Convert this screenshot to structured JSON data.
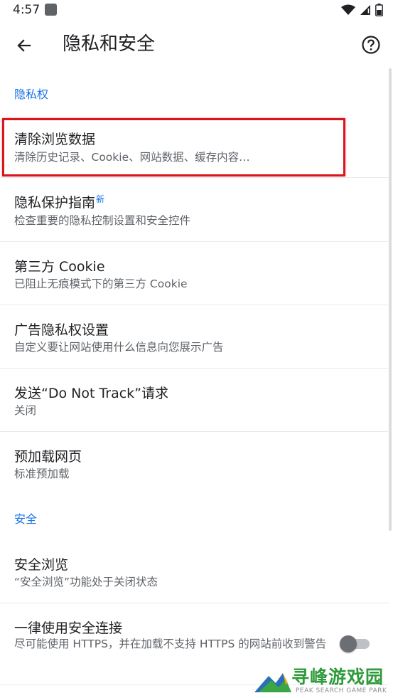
{
  "status_bar": {
    "time": "4:57"
  },
  "header": {
    "title": "隐私和安全"
  },
  "sections": {
    "privacy_header": "隐私权",
    "security_header": "安全"
  },
  "items": {
    "clear_data": {
      "title": "清除浏览数据",
      "subtitle": "清除历史记录、Cookie、网站数据、缓存内容…"
    },
    "privacy_guide": {
      "title": "隐私保护指南",
      "badge": "新",
      "subtitle": "检查重要的隐私控制设置和安全控件"
    },
    "third_party_cookie": {
      "title": "第三方 Cookie",
      "subtitle": "已阻止无痕模式下的第三方 Cookie"
    },
    "ad_privacy": {
      "title": "广告隐私权设置",
      "subtitle": "自定义要让网站使用什么信息向您展示广告"
    },
    "do_not_track": {
      "title": "发送“Do Not Track”请求",
      "subtitle": "关闭"
    },
    "preload": {
      "title": "预加载网页",
      "subtitle": "标准预加载"
    },
    "safe_browsing": {
      "title": "安全浏览",
      "subtitle": "“安全浏览”功能处于关闭状态"
    },
    "https_first": {
      "title": "一律使用安全连接",
      "subtitle": "尽可能使用 HTTPS，并在加载不支持 HTTPS 的网站前收到警告",
      "toggle_on": false
    }
  },
  "watermark": {
    "name": "寻峰游戏园",
    "sub": "PEAK SEARCH GAME PARK"
  },
  "colors": {
    "accent": "#1a73e8",
    "highlight": "#d9161d",
    "watermark": "#2e9b3a"
  }
}
